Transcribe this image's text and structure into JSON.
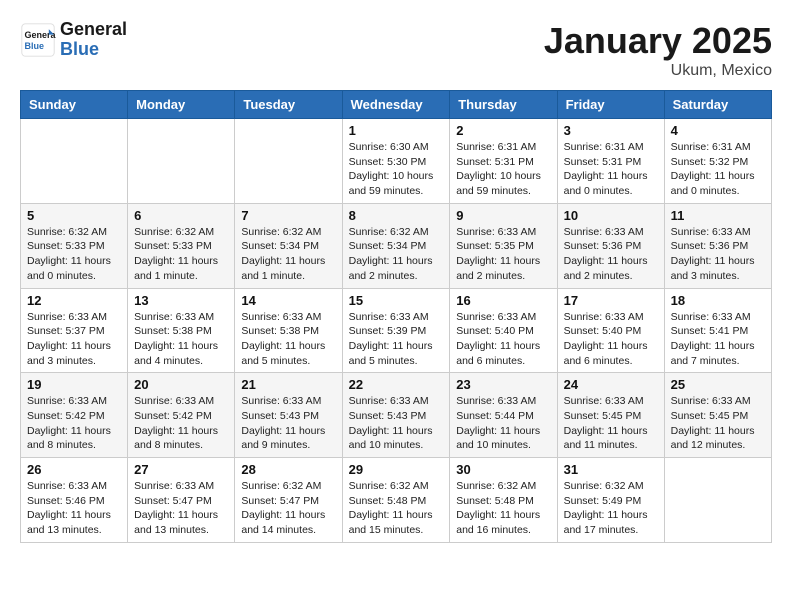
{
  "header": {
    "logo_general": "General",
    "logo_blue": "Blue",
    "month_title": "January 2025",
    "location": "Ukum, Mexico"
  },
  "weekdays": [
    "Sunday",
    "Monday",
    "Tuesday",
    "Wednesday",
    "Thursday",
    "Friday",
    "Saturday"
  ],
  "weeks": [
    [
      {
        "day": "",
        "info": ""
      },
      {
        "day": "",
        "info": ""
      },
      {
        "day": "",
        "info": ""
      },
      {
        "day": "1",
        "info": "Sunrise: 6:30 AM\nSunset: 5:30 PM\nDaylight: 10 hours\nand 59 minutes."
      },
      {
        "day": "2",
        "info": "Sunrise: 6:31 AM\nSunset: 5:31 PM\nDaylight: 10 hours\nand 59 minutes."
      },
      {
        "day": "3",
        "info": "Sunrise: 6:31 AM\nSunset: 5:31 PM\nDaylight: 11 hours\nand 0 minutes."
      },
      {
        "day": "4",
        "info": "Sunrise: 6:31 AM\nSunset: 5:32 PM\nDaylight: 11 hours\nand 0 minutes."
      }
    ],
    [
      {
        "day": "5",
        "info": "Sunrise: 6:32 AM\nSunset: 5:33 PM\nDaylight: 11 hours\nand 0 minutes."
      },
      {
        "day": "6",
        "info": "Sunrise: 6:32 AM\nSunset: 5:33 PM\nDaylight: 11 hours\nand 1 minute."
      },
      {
        "day": "7",
        "info": "Sunrise: 6:32 AM\nSunset: 5:34 PM\nDaylight: 11 hours\nand 1 minute."
      },
      {
        "day": "8",
        "info": "Sunrise: 6:32 AM\nSunset: 5:34 PM\nDaylight: 11 hours\nand 2 minutes."
      },
      {
        "day": "9",
        "info": "Sunrise: 6:33 AM\nSunset: 5:35 PM\nDaylight: 11 hours\nand 2 minutes."
      },
      {
        "day": "10",
        "info": "Sunrise: 6:33 AM\nSunset: 5:36 PM\nDaylight: 11 hours\nand 2 minutes."
      },
      {
        "day": "11",
        "info": "Sunrise: 6:33 AM\nSunset: 5:36 PM\nDaylight: 11 hours\nand 3 minutes."
      }
    ],
    [
      {
        "day": "12",
        "info": "Sunrise: 6:33 AM\nSunset: 5:37 PM\nDaylight: 11 hours\nand 3 minutes."
      },
      {
        "day": "13",
        "info": "Sunrise: 6:33 AM\nSunset: 5:38 PM\nDaylight: 11 hours\nand 4 minutes."
      },
      {
        "day": "14",
        "info": "Sunrise: 6:33 AM\nSunset: 5:38 PM\nDaylight: 11 hours\nand 5 minutes."
      },
      {
        "day": "15",
        "info": "Sunrise: 6:33 AM\nSunset: 5:39 PM\nDaylight: 11 hours\nand 5 minutes."
      },
      {
        "day": "16",
        "info": "Sunrise: 6:33 AM\nSunset: 5:40 PM\nDaylight: 11 hours\nand 6 minutes."
      },
      {
        "day": "17",
        "info": "Sunrise: 6:33 AM\nSunset: 5:40 PM\nDaylight: 11 hours\nand 6 minutes."
      },
      {
        "day": "18",
        "info": "Sunrise: 6:33 AM\nSunset: 5:41 PM\nDaylight: 11 hours\nand 7 minutes."
      }
    ],
    [
      {
        "day": "19",
        "info": "Sunrise: 6:33 AM\nSunset: 5:42 PM\nDaylight: 11 hours\nand 8 minutes."
      },
      {
        "day": "20",
        "info": "Sunrise: 6:33 AM\nSunset: 5:42 PM\nDaylight: 11 hours\nand 8 minutes."
      },
      {
        "day": "21",
        "info": "Sunrise: 6:33 AM\nSunset: 5:43 PM\nDaylight: 11 hours\nand 9 minutes."
      },
      {
        "day": "22",
        "info": "Sunrise: 6:33 AM\nSunset: 5:43 PM\nDaylight: 11 hours\nand 10 minutes."
      },
      {
        "day": "23",
        "info": "Sunrise: 6:33 AM\nSunset: 5:44 PM\nDaylight: 11 hours\nand 10 minutes."
      },
      {
        "day": "24",
        "info": "Sunrise: 6:33 AM\nSunset: 5:45 PM\nDaylight: 11 hours\nand 11 minutes."
      },
      {
        "day": "25",
        "info": "Sunrise: 6:33 AM\nSunset: 5:45 PM\nDaylight: 11 hours\nand 12 minutes."
      }
    ],
    [
      {
        "day": "26",
        "info": "Sunrise: 6:33 AM\nSunset: 5:46 PM\nDaylight: 11 hours\nand 13 minutes."
      },
      {
        "day": "27",
        "info": "Sunrise: 6:33 AM\nSunset: 5:47 PM\nDaylight: 11 hours\nand 13 minutes."
      },
      {
        "day": "28",
        "info": "Sunrise: 6:32 AM\nSunset: 5:47 PM\nDaylight: 11 hours\nand 14 minutes."
      },
      {
        "day": "29",
        "info": "Sunrise: 6:32 AM\nSunset: 5:48 PM\nDaylight: 11 hours\nand 15 minutes."
      },
      {
        "day": "30",
        "info": "Sunrise: 6:32 AM\nSunset: 5:48 PM\nDaylight: 11 hours\nand 16 minutes."
      },
      {
        "day": "31",
        "info": "Sunrise: 6:32 AM\nSunset: 5:49 PM\nDaylight: 11 hours\nand 17 minutes."
      },
      {
        "day": "",
        "info": ""
      }
    ]
  ]
}
